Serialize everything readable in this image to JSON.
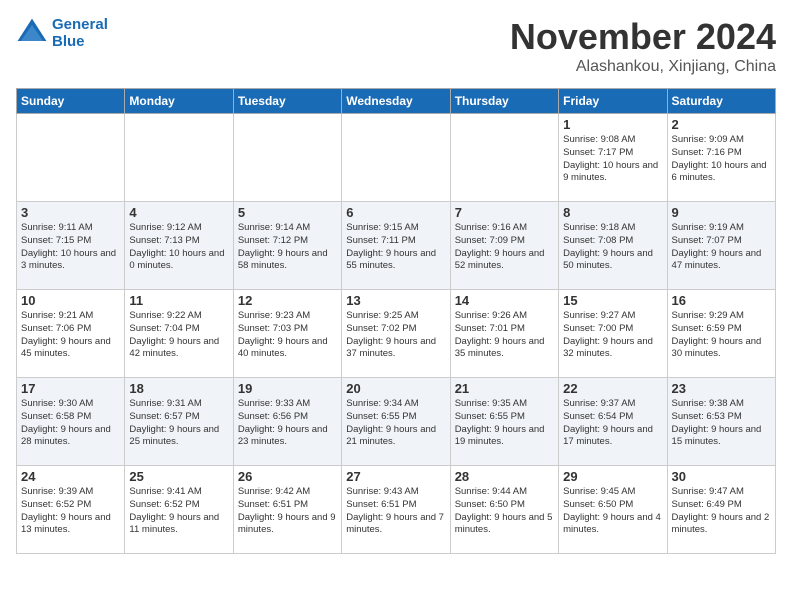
{
  "logo": {
    "line1": "General",
    "line2": "Blue"
  },
  "header": {
    "month": "November 2024",
    "location": "Alashankou, Xinjiang, China"
  },
  "weekdays": [
    "Sunday",
    "Monday",
    "Tuesday",
    "Wednesday",
    "Thursday",
    "Friday",
    "Saturday"
  ],
  "weeks": [
    [
      {
        "day": "",
        "text": ""
      },
      {
        "day": "",
        "text": ""
      },
      {
        "day": "",
        "text": ""
      },
      {
        "day": "",
        "text": ""
      },
      {
        "day": "",
        "text": ""
      },
      {
        "day": "1",
        "text": "Sunrise: 9:08 AM\nSunset: 7:17 PM\nDaylight: 10 hours and 9 minutes."
      },
      {
        "day": "2",
        "text": "Sunrise: 9:09 AM\nSunset: 7:16 PM\nDaylight: 10 hours and 6 minutes."
      }
    ],
    [
      {
        "day": "3",
        "text": "Sunrise: 9:11 AM\nSunset: 7:15 PM\nDaylight: 10 hours and 3 minutes."
      },
      {
        "day": "4",
        "text": "Sunrise: 9:12 AM\nSunset: 7:13 PM\nDaylight: 10 hours and 0 minutes."
      },
      {
        "day": "5",
        "text": "Sunrise: 9:14 AM\nSunset: 7:12 PM\nDaylight: 9 hours and 58 minutes."
      },
      {
        "day": "6",
        "text": "Sunrise: 9:15 AM\nSunset: 7:11 PM\nDaylight: 9 hours and 55 minutes."
      },
      {
        "day": "7",
        "text": "Sunrise: 9:16 AM\nSunset: 7:09 PM\nDaylight: 9 hours and 52 minutes."
      },
      {
        "day": "8",
        "text": "Sunrise: 9:18 AM\nSunset: 7:08 PM\nDaylight: 9 hours and 50 minutes."
      },
      {
        "day": "9",
        "text": "Sunrise: 9:19 AM\nSunset: 7:07 PM\nDaylight: 9 hours and 47 minutes."
      }
    ],
    [
      {
        "day": "10",
        "text": "Sunrise: 9:21 AM\nSunset: 7:06 PM\nDaylight: 9 hours and 45 minutes."
      },
      {
        "day": "11",
        "text": "Sunrise: 9:22 AM\nSunset: 7:04 PM\nDaylight: 9 hours and 42 minutes."
      },
      {
        "day": "12",
        "text": "Sunrise: 9:23 AM\nSunset: 7:03 PM\nDaylight: 9 hours and 40 minutes."
      },
      {
        "day": "13",
        "text": "Sunrise: 9:25 AM\nSunset: 7:02 PM\nDaylight: 9 hours and 37 minutes."
      },
      {
        "day": "14",
        "text": "Sunrise: 9:26 AM\nSunset: 7:01 PM\nDaylight: 9 hours and 35 minutes."
      },
      {
        "day": "15",
        "text": "Sunrise: 9:27 AM\nSunset: 7:00 PM\nDaylight: 9 hours and 32 minutes."
      },
      {
        "day": "16",
        "text": "Sunrise: 9:29 AM\nSunset: 6:59 PM\nDaylight: 9 hours and 30 minutes."
      }
    ],
    [
      {
        "day": "17",
        "text": "Sunrise: 9:30 AM\nSunset: 6:58 PM\nDaylight: 9 hours and 28 minutes."
      },
      {
        "day": "18",
        "text": "Sunrise: 9:31 AM\nSunset: 6:57 PM\nDaylight: 9 hours and 25 minutes."
      },
      {
        "day": "19",
        "text": "Sunrise: 9:33 AM\nSunset: 6:56 PM\nDaylight: 9 hours and 23 minutes."
      },
      {
        "day": "20",
        "text": "Sunrise: 9:34 AM\nSunset: 6:55 PM\nDaylight: 9 hours and 21 minutes."
      },
      {
        "day": "21",
        "text": "Sunrise: 9:35 AM\nSunset: 6:55 PM\nDaylight: 9 hours and 19 minutes."
      },
      {
        "day": "22",
        "text": "Sunrise: 9:37 AM\nSunset: 6:54 PM\nDaylight: 9 hours and 17 minutes."
      },
      {
        "day": "23",
        "text": "Sunrise: 9:38 AM\nSunset: 6:53 PM\nDaylight: 9 hours and 15 minutes."
      }
    ],
    [
      {
        "day": "24",
        "text": "Sunrise: 9:39 AM\nSunset: 6:52 PM\nDaylight: 9 hours and 13 minutes."
      },
      {
        "day": "25",
        "text": "Sunrise: 9:41 AM\nSunset: 6:52 PM\nDaylight: 9 hours and 11 minutes."
      },
      {
        "day": "26",
        "text": "Sunrise: 9:42 AM\nSunset: 6:51 PM\nDaylight: 9 hours and 9 minutes."
      },
      {
        "day": "27",
        "text": "Sunrise: 9:43 AM\nSunset: 6:51 PM\nDaylight: 9 hours and 7 minutes."
      },
      {
        "day": "28",
        "text": "Sunrise: 9:44 AM\nSunset: 6:50 PM\nDaylight: 9 hours and 5 minutes."
      },
      {
        "day": "29",
        "text": "Sunrise: 9:45 AM\nSunset: 6:50 PM\nDaylight: 9 hours and 4 minutes."
      },
      {
        "day": "30",
        "text": "Sunrise: 9:47 AM\nSunset: 6:49 PM\nDaylight: 9 hours and 2 minutes."
      }
    ]
  ]
}
